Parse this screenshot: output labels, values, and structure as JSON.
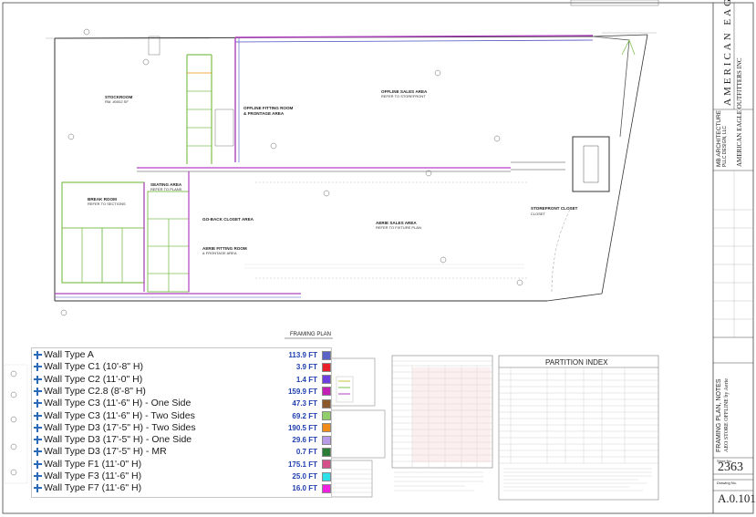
{
  "plan": {
    "title": "FRAMING PLAN",
    "rooms": {
      "stockroom": "STOCKROOM",
      "outline_fitting": "OFFLINE FITTING ROOM",
      "frontage": "& FRONTAGE AREA",
      "offline_sales": "OFFLINE SALES AREA",
      "break_room": "BREAK ROOM",
      "seating": "SEATING AREA",
      "go_back": "GO-BACK CLOSET AREA",
      "aerie_fitting": "AERIE FITTING ROOM",
      "aerie_sales": "AERIE SALES AREA",
      "storefront_closet": "STOREFRONT CLOSET"
    },
    "tables": {
      "partition_index": "PARTITION INDEX"
    }
  },
  "legend": {
    "items": [
      {
        "name": "Wall Type A",
        "qty": "113.9 FT",
        "color": "#5b63c8"
      },
      {
        "name": "Wall Type C1 (10'-8\" H)",
        "qty": "3.9 FT",
        "color": "#e8202a"
      },
      {
        "name": "Wall Type C2 (11'-0\" H)",
        "qty": "1.4 FT",
        "color": "#6e3fe0"
      },
      {
        "name": "Wall Type C2.8 (8'-8\" H)",
        "qty": "159.9 FT",
        "color": "#c21fb5"
      },
      {
        "name": "Wall Type C3 (11'-6\" H) - One Side",
        "qty": "47.3 FT",
        "color": "#8a5a2b"
      },
      {
        "name": "Wall Type C3 (11'-6\" H) - Two Sides",
        "qty": "69.2 FT",
        "color": "#8fce6a"
      },
      {
        "name": "Wall Type D3 (17'-5\" H) - Two Sides",
        "qty": "190.5 FT",
        "color": "#f08b1a"
      },
      {
        "name": "Wall Type D3 (17'-5\" H) - One Side",
        "qty": "29.6 FT",
        "color": "#b79be8"
      },
      {
        "name": "Wall Type D3 (17'-5\" H) - MR",
        "qty": "0.7 FT",
        "color": "#2d7d3a"
      },
      {
        "name": "Wall Type F1 (11'-0\" H)",
        "qty": "175.1 FT",
        "color": "#d4508a"
      },
      {
        "name": "Wall Type F3 (11'-6\" H)",
        "qty": "25.0 FT",
        "color": "#30e0e8"
      },
      {
        "name": "Wall Type F7 (11'-6\" H)",
        "qty": "16.0 FT",
        "color": "#f020e0"
      }
    ]
  },
  "title_block": {
    "brand": "AMERICAN EAGLE",
    "architect": "MB ARCHITECTURE",
    "architect_sub": "PLLC DESIGN, LLC",
    "client": "AMERICAN EAGLE OUTFITTERS INC",
    "sheet_title": "FRAMING PLAN, NOTES",
    "sheet_sub": "AEO STORE OFFLINE by Aerie",
    "store_label": "Store No.",
    "store_no": "2363",
    "drawing_label": "Drawing No.",
    "drawing_no": "A.0.101"
  }
}
